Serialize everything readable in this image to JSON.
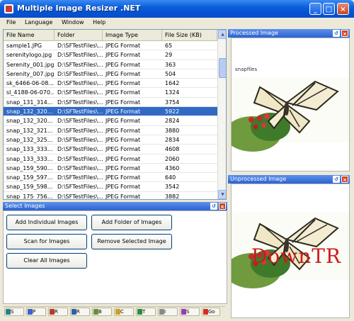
{
  "title": "Multiple Image Resizer .NET",
  "menu": [
    "File",
    "Language",
    "Window",
    "Help"
  ],
  "columns": [
    "File Name",
    "Folder",
    "Image Type",
    "File Size (KB)"
  ],
  "rows": [
    {
      "name": "sample1.JPG",
      "folder": "D:\\SFTestFiles\\...",
      "type": "JPEG Format",
      "size": "65"
    },
    {
      "name": "serenitylogo.jpg",
      "folder": "D:\\SFTestFiles\\...",
      "type": "JPEG Format",
      "size": "29"
    },
    {
      "name": "Serenity_001.jpg",
      "folder": "D:\\SFTestFiles\\...",
      "type": "JPEG Format",
      "size": "363"
    },
    {
      "name": "Serenity_007.jpg",
      "folder": "D:\\SFTestFiles\\...",
      "type": "JPEG Format",
      "size": "504"
    },
    {
      "name": "sk_6466-06-08...",
      "folder": "D:\\SFTestFiles\\...",
      "type": "JPEG Format",
      "size": "1642"
    },
    {
      "name": "sl_4188-06-070...",
      "folder": "D:\\SFTestFiles\\...",
      "type": "JPEG Format",
      "size": "1324"
    },
    {
      "name": "snap_131_314...",
      "folder": "D:\\SFTestFiles\\...",
      "type": "JPEG Format",
      "size": "3754"
    },
    {
      "name": "snap_132_320...",
      "folder": "D:\\SFTestFiles\\...",
      "type": "JPEG Format",
      "size": "5922",
      "selected": true
    },
    {
      "name": "snap_132_320...",
      "folder": "D:\\SFTestFiles\\...",
      "type": "JPEG Format",
      "size": "2824"
    },
    {
      "name": "snap_132_321...",
      "folder": "D:\\SFTestFiles\\...",
      "type": "JPEG Format",
      "size": "3880"
    },
    {
      "name": "snap_132_325...",
      "folder": "D:\\SFTestFiles\\...",
      "type": "JPEG Format",
      "size": "2834"
    },
    {
      "name": "snap_133_333...",
      "folder": "D:\\SFTestFiles\\...",
      "type": "JPEG Format",
      "size": "4608"
    },
    {
      "name": "snap_133_333...",
      "folder": "D:\\SFTestFiles\\...",
      "type": "JPEG Format",
      "size": "2060"
    },
    {
      "name": "snap_159_590...",
      "folder": "D:\\SFTestFiles\\...",
      "type": "JPEG Format",
      "size": "4360"
    },
    {
      "name": "snap_159_597...",
      "folder": "D:\\SFTestFiles\\...",
      "type": "JPEG Format",
      "size": "640"
    },
    {
      "name": "snap_159_598...",
      "folder": "D:\\SFTestFiles\\...",
      "type": "JPEG Format",
      "size": "3542"
    },
    {
      "name": "snap_175_756...",
      "folder": "D:\\SFTestFiles\\...",
      "type": "JPEG Format",
      "size": "3882"
    }
  ],
  "select_panel": {
    "title": "Select Images",
    "buttons": {
      "add_individual": "Add Individual Images",
      "add_folder": "Add Folder of Images",
      "scan": "Scan for Images",
      "remove": "Remove Selected Image",
      "clear": "Clear All Images"
    }
  },
  "processed": {
    "title": "Processed Image",
    "caption": "snapfiles"
  },
  "unprocessed": {
    "title": "Unprocessed Image"
  },
  "watermark": "DownTR",
  "taskbar": [
    {
      "label": "S",
      "color": "#2a7f88"
    },
    {
      "label": "P",
      "color": "#3b63c8"
    },
    {
      "label": "R",
      "color": "#b83a2c"
    },
    {
      "label": "R",
      "color": "#2a5fb0"
    },
    {
      "label": "B",
      "color": "#6a8f3a"
    },
    {
      "label": "C",
      "color": "#c9a227"
    },
    {
      "label": "T",
      "color": "#2f8a3b"
    },
    {
      "label": "I",
      "color": "#8a8a8a"
    },
    {
      "label": "S",
      "color": "#9a3bb0"
    },
    {
      "label": "Go",
      "color": "#d62d20"
    }
  ]
}
